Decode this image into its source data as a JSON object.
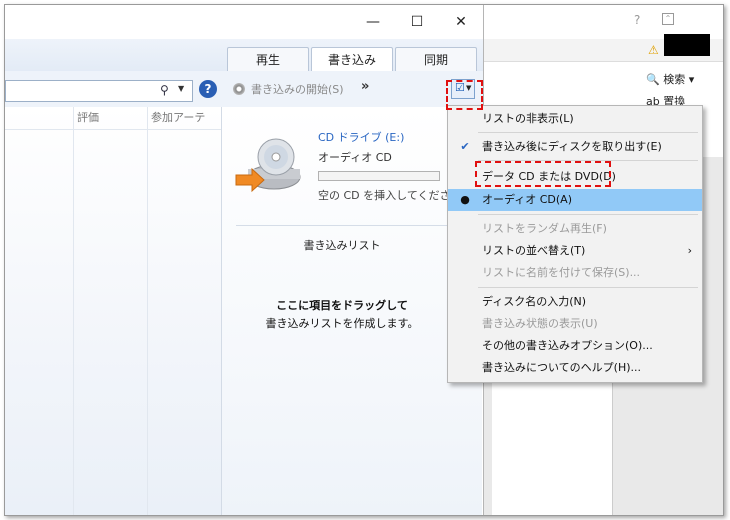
{
  "wmp": {
    "window_controls": {
      "minimize": "—",
      "maximize": "☐",
      "close": "✕"
    },
    "tabs": [
      {
        "label": "再生"
      },
      {
        "label": "書き込み"
      },
      {
        "label": "同期"
      }
    ],
    "toolbar": {
      "start_burn": "書き込みの開始(S)",
      "more": "»"
    },
    "library_columns": [
      "評価",
      "参加アーテ"
    ],
    "burn": {
      "drive_name": "CD ドライブ (E:)",
      "drive_type": "オーディオ CD",
      "insert_message": "空の CD を挿入してください",
      "burn_list_title": "書き込みリスト",
      "drag_line1": "ここに項目をドラッグして",
      "drag_line2": "書き込みリストを作成します。"
    }
  },
  "menu": {
    "items": [
      {
        "label": "リストの非表示(L)",
        "enabled": true
      },
      {
        "label": "書き込み後にディスクを取り出す(E)",
        "enabled": true,
        "checked": true
      },
      {
        "label": "データ CD または DVD(D)",
        "enabled": true
      },
      {
        "label": "オーディオ CD(A)",
        "enabled": true,
        "selected": true
      },
      {
        "label": "リストをランダム再生(F)",
        "enabled": false
      },
      {
        "label": "リストの並べ替え(T)",
        "enabled": true,
        "submenu": true
      },
      {
        "label": "リストに名前を付けて保存(S)...",
        "enabled": false
      },
      {
        "label": "ディスク名の入力(N)",
        "enabled": true
      },
      {
        "label": "書き込み状態の表示(U)",
        "enabled": false
      },
      {
        "label": "その他の書き込みオプション(O)...",
        "enabled": true
      },
      {
        "label": "書き込みについてのヘルプ(H)...",
        "enabled": true
      }
    ]
  },
  "background_window": {
    "help": "?",
    "find_label": "検索",
    "replace_label": "置換"
  },
  "colors": {
    "accent": "#2a66c2",
    "menu_highlight": "#91c9f7",
    "annotation": "#e01010"
  }
}
